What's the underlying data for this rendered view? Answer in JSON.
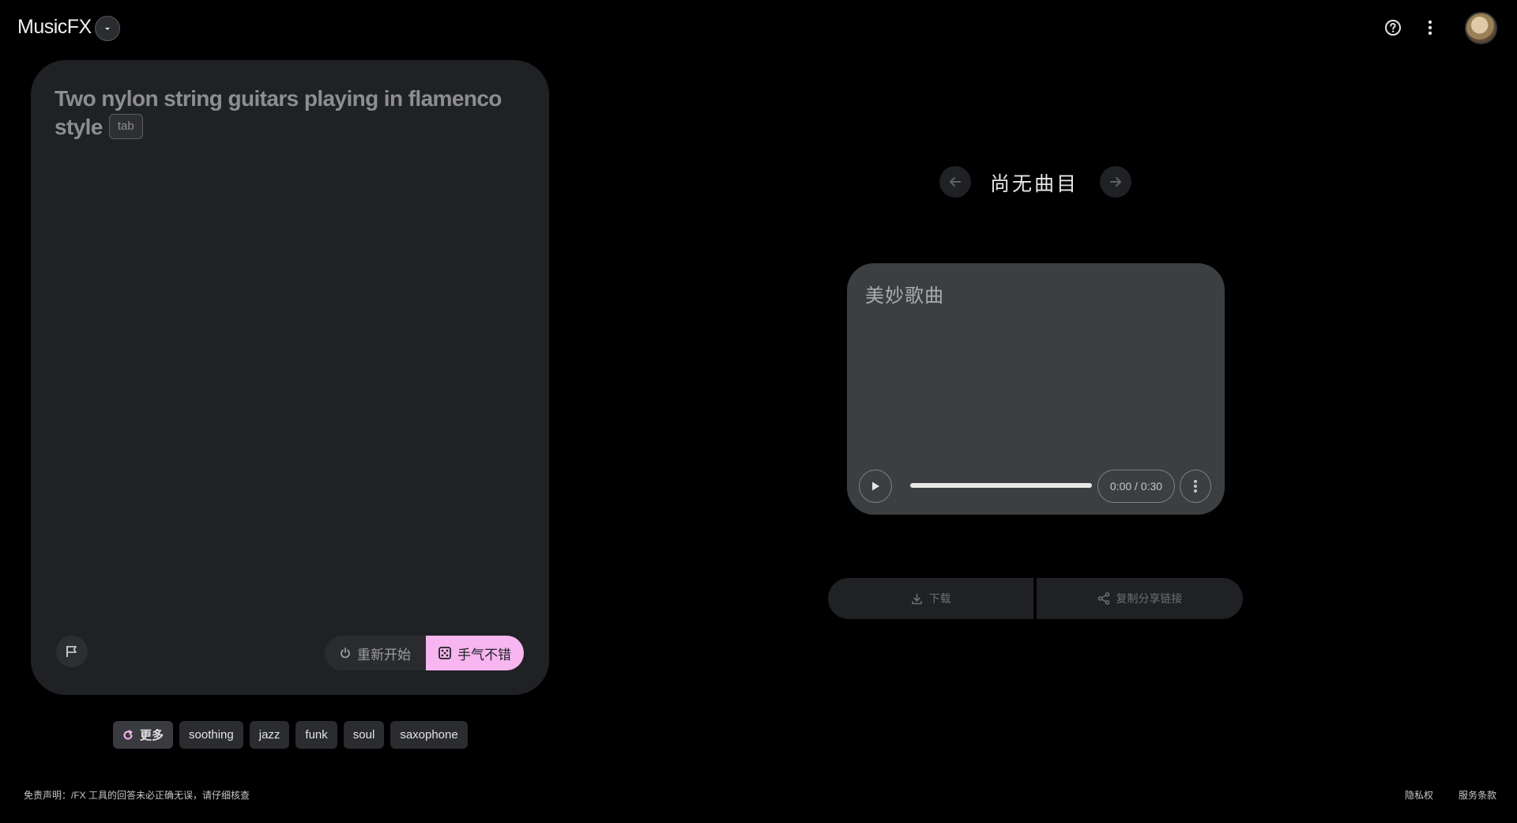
{
  "header": {
    "app_title": "MusicFX",
    "icons": [
      "chevron-down-icon",
      "help-icon",
      "more-vert-icon",
      "avatar"
    ]
  },
  "prompt": {
    "text": "Two nylon string guitars playing in flamenco style",
    "tab_hint": "tab",
    "reset_label": "重新开始",
    "lucky_label": "手气不错",
    "accent_color": "#f7b6f0"
  },
  "chips": {
    "more_label": "更多",
    "items": [
      "soothing",
      "jazz",
      "funk",
      "soul",
      "saxophone"
    ]
  },
  "player": {
    "track_title": "尚无曲目",
    "song_name": "美妙歌曲",
    "time": "0:00 / 0:30",
    "progress": 1.0,
    "download_label": "下载",
    "share_label": "复制分享链接"
  },
  "footer": {
    "disclaimer": "免责声明：/FX 工具的回答未必正确无误，请仔细核查",
    "privacy": "隐私权",
    "terms": "服务条款"
  }
}
